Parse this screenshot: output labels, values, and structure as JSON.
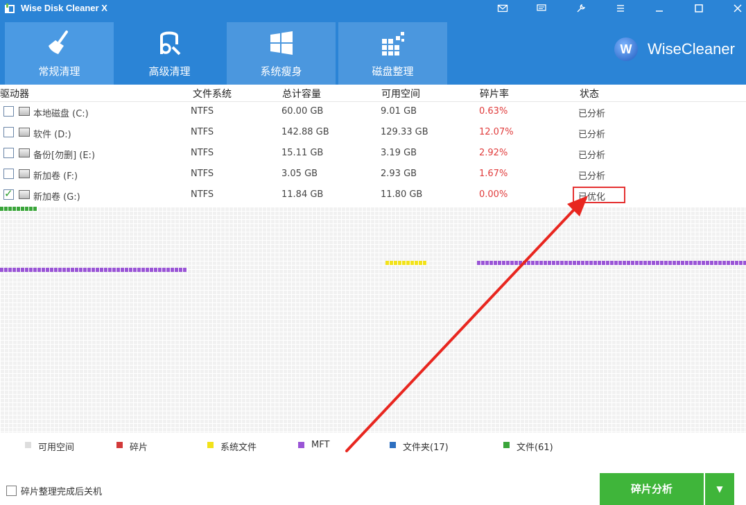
{
  "window": {
    "title": "Wise Disk Cleaner X"
  },
  "tabs": [
    {
      "label": "常规清理",
      "icon": "broom-icon"
    },
    {
      "label": "高级清理",
      "icon": "disk-clean-icon"
    },
    {
      "label": "系统瘦身",
      "icon": "windows-icon"
    },
    {
      "label": "磁盘整理",
      "icon": "defrag-icon"
    }
  ],
  "brand": {
    "text": "WiseCleaner",
    "logo": "W"
  },
  "table": {
    "headers": [
      "驱动器",
      "文件系统",
      "总计容量",
      "可用空间",
      "碎片率",
      "状态"
    ],
    "rows": [
      {
        "name": "本地磁盘 (C:)",
        "fs": "NTFS",
        "total": "60.00 GB",
        "free": "9.01 GB",
        "frag": "0.63%",
        "status": "已分析",
        "checked": false
      },
      {
        "name": "软件 (D:)",
        "fs": "NTFS",
        "total": "142.88 GB",
        "free": "129.33 GB",
        "frag": "12.07%",
        "status": "已分析",
        "checked": false
      },
      {
        "name": "备份[勿删] (E:)",
        "fs": "NTFS",
        "total": "15.11 GB",
        "free": "3.19 GB",
        "frag": "2.92%",
        "status": "已分析",
        "checked": false
      },
      {
        "name": "新加卷 (F:)",
        "fs": "NTFS",
        "total": "3.05 GB",
        "free": "2.93 GB",
        "frag": "1.67%",
        "status": "已分析",
        "checked": false
      },
      {
        "name": "新加卷 (G:)",
        "fs": "NTFS",
        "total": "11.84 GB",
        "free": "11.80 GB",
        "frag": "0.00%",
        "status": "已优化",
        "checked": true
      }
    ]
  },
  "legend": [
    {
      "label": "可用空间",
      "color": "#dddddd"
    },
    {
      "label": "碎片",
      "color": "#d23a3a"
    },
    {
      "label": "系统文件",
      "color": "#f2e21a"
    },
    {
      "label": "MFT",
      "color": "#9a55d6"
    },
    {
      "label": "文件夹(17)",
      "color": "#2d6fc0"
    },
    {
      "label": "文件(61)",
      "color": "#3aa53a"
    }
  ],
  "footer": {
    "shutdown_label": "碎片整理完成后关机",
    "analyze_button": "碎片分析"
  },
  "colors": {
    "header": "#2b84d6",
    "accent_green": "#3fb53a",
    "frag_red": "#e03b3b"
  }
}
